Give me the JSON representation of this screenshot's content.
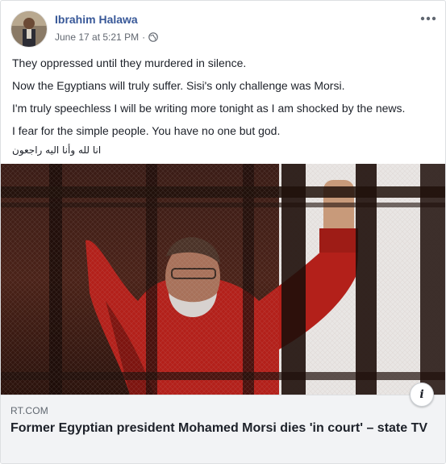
{
  "post": {
    "author": "Ibrahim Halawa",
    "date": "June 17 at 5:21 PM",
    "separator": "·",
    "privacy_icon": "globe-icon",
    "more_icon": "ellipsis-icon",
    "text_lines": [
      "They oppressed until they murdered in silence.",
      "Now the Egyptians will truly suffer. Sisi's only challenge was Morsi.",
      "I'm truly speechless I will be writing more tonight as I am shocked by the news.",
      "I fear for the simple people. You have no one but god.",
      "انا لله وأنا اليه راجعون"
    ]
  },
  "link_preview": {
    "domain": "RT.COM",
    "headline": "Former Egyptian president Mohamed Morsi dies 'in court' – state TV",
    "info_label": "i",
    "image_icon": "photo-of-man-in-red-behind-cage-bars"
  },
  "colors": {
    "author": "#385898",
    "meta": "#616770",
    "caption_bg": "#f2f3f5",
    "border": "#dddfe2"
  }
}
